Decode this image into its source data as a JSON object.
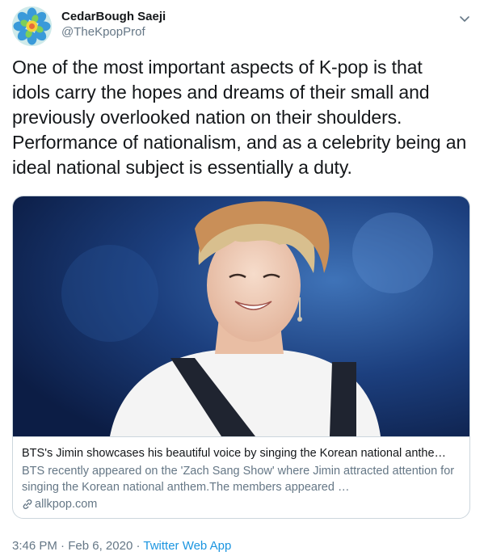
{
  "author": {
    "name": "CedarBough Saeji",
    "handle": "@TheKpopProf",
    "avatar_icon": "flower-avatar"
  },
  "menu_icon": "chevron-down-icon",
  "tweet": {
    "text": "One of the most important aspects of K-pop is that\nidols carry the hopes and dreams of their small and\npreviously overlooked nation on their shoulders.\nPerformance of nationalism, and as a celebrity being an\nideal national subject is essentially a duty."
  },
  "card": {
    "title": "BTS's Jimin showcases his beautiful voice by singing the Korean national anthe…",
    "description": "BTS recently appeared on the 'Zach Sang Show' where Jimin attracted attention for singing the Korean national anthem.The members appeared …",
    "domain": "allkpop.com",
    "link_icon": "link-icon"
  },
  "footer": {
    "time": "3:46 PM",
    "separator": "·",
    "date": "Feb 6, 2020",
    "source": "Twitter Web App"
  },
  "colors": {
    "text": "#14171a",
    "secondary": "#657786",
    "link": "#1b95e0",
    "border": "#ccd6dd"
  }
}
